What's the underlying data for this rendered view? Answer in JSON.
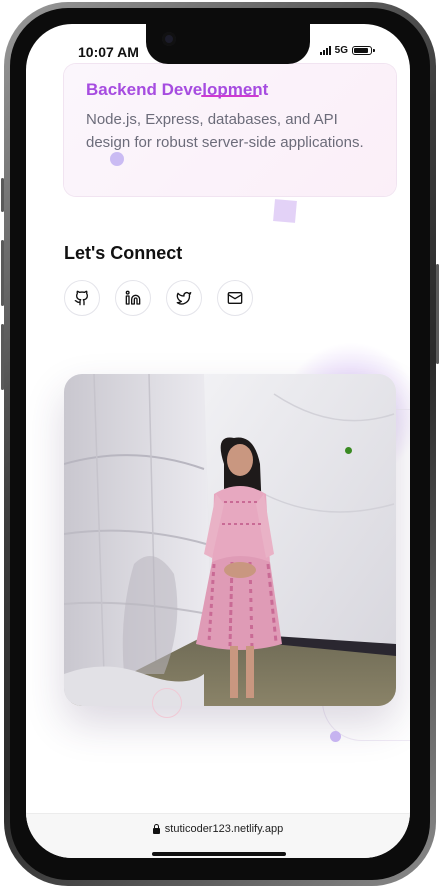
{
  "status_bar": {
    "time": "10:07 AM",
    "network": "5G",
    "battery_level": 0.9
  },
  "card": {
    "title": "Backend Development",
    "description": "Node.js, Express, databases, and API design for robust server-side applications."
  },
  "connect": {
    "title": "Let's Connect",
    "socials": [
      {
        "name": "github",
        "icon": "github-icon"
      },
      {
        "name": "linkedin",
        "icon": "linkedin-icon"
      },
      {
        "name": "twitter",
        "icon": "twitter-icon"
      },
      {
        "name": "email",
        "icon": "mail-icon"
      }
    ]
  },
  "photo": {
    "alt": "profile-photo"
  },
  "browser": {
    "url": "stuticoder123.netlify.app"
  },
  "colors": {
    "accent": "#a64ce0",
    "text_muted": "#6c6c7a"
  }
}
